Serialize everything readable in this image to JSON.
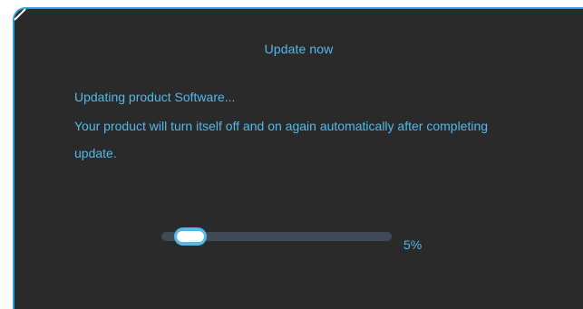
{
  "dialog": {
    "title": "Update now",
    "message_line_1": "Updating product Software...",
    "message_line_2": "Your product will turn itself off and on again automatically after completing",
    "message_line_3": "update.",
    "progress": {
      "percent": 5,
      "label": "5%"
    }
  },
  "colors": {
    "accent": "#54b8e8",
    "border": "#2e9bd6",
    "background": "#2b2a2a",
    "track": "#3f4a54"
  }
}
